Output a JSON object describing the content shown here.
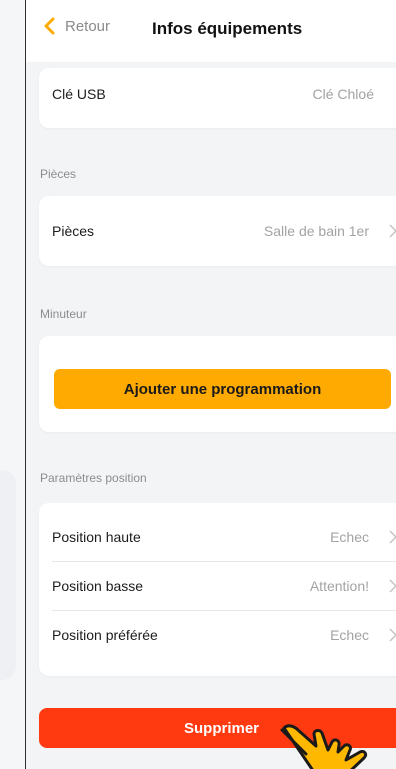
{
  "header": {
    "back_label": "Retour",
    "title": "Infos équipements"
  },
  "usb_row": {
    "label": "Clé USB",
    "value": "Clé Chloé"
  },
  "rooms_section": {
    "title": "Pièces",
    "row": {
      "label": "Pièces",
      "value": "Salle de bain 1er"
    }
  },
  "timer_section": {
    "title": "Minuteur",
    "add_button": "Ajouter une programmation"
  },
  "position_section": {
    "title": "Paramètres position",
    "rows": [
      {
        "label": "Position haute",
        "value": "Echec"
      },
      {
        "label": "Position basse",
        "value": "Attention!"
      },
      {
        "label": "Position préférée",
        "value": "Echec"
      }
    ]
  },
  "delete_button": "Supprimer",
  "colors": {
    "accent_orange": "#ffaa00",
    "delete_red": "#ff3a10",
    "back_chevron": "#ffaa00"
  },
  "icons": {
    "back": "chevron-left-icon",
    "row_arrow": "chevron-right-icon",
    "pointer": "pointing-hand-icon"
  }
}
